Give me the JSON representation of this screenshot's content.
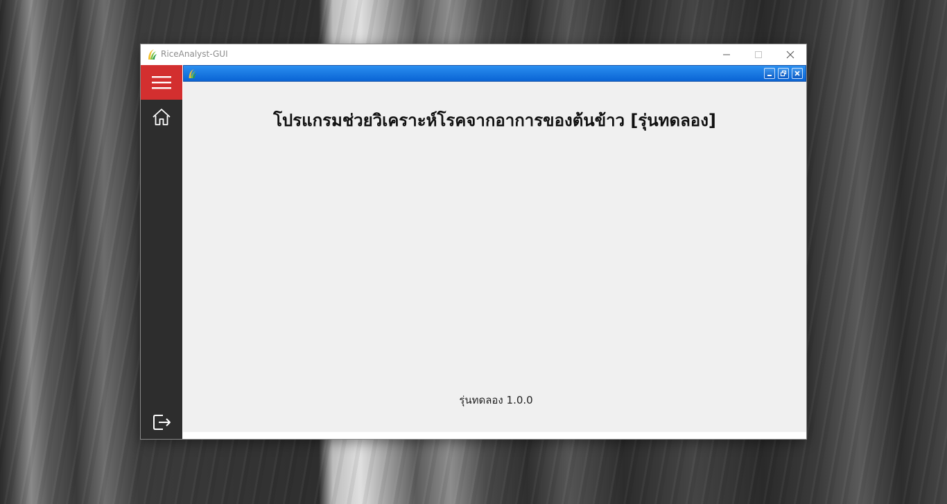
{
  "window": {
    "title": "RiceAnalyst-GUI",
    "icon": "rice-leaf-icon"
  },
  "sidebar": {
    "accent_color": "#d32f2f",
    "background_color": "#2d2d2d",
    "items": [
      {
        "name": "menu",
        "icon": "hamburger-menu-icon"
      },
      {
        "name": "home",
        "icon": "home-icon"
      },
      {
        "name": "logout",
        "icon": "logout-icon"
      }
    ]
  },
  "child_window": {
    "titlebar_color": "#0a64d4",
    "icon": "rice-leaf-icon",
    "buttons": [
      "minimize",
      "restore",
      "close"
    ]
  },
  "main": {
    "heading": "โปรแกรมช่วยวิเคราะห์โรคจากอาการของต้นข้าว [รุ่นทดลอง]",
    "version_label": "รุ่นทดลอง 1.0.0"
  }
}
